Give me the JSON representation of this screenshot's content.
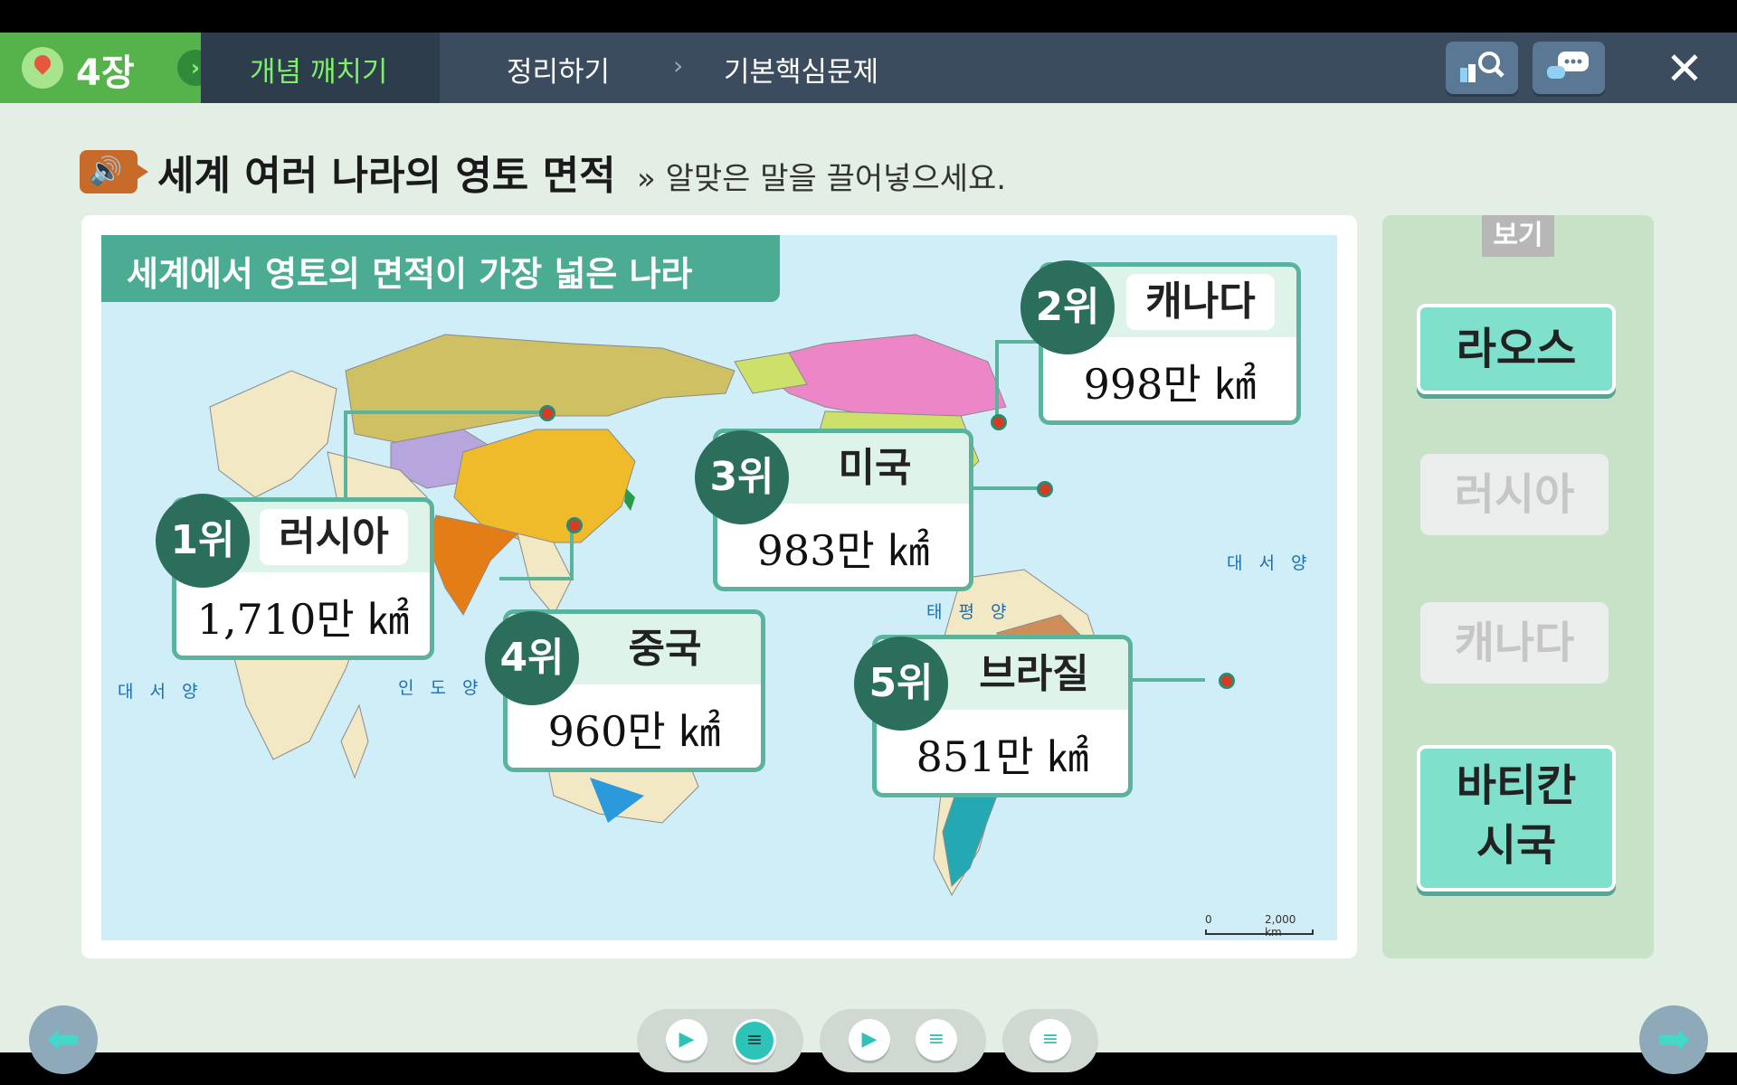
{
  "topbar": {
    "chapter": "4장",
    "tabs": [
      "개념 깨치기",
      "정리하기",
      "기본핵심문제"
    ],
    "separator": "›",
    "close_label": "✕"
  },
  "heading": {
    "title": "세계 여러 나라의 영토 면적",
    "instruction": "» 알맞은 말을 끌어넣으세요."
  },
  "map": {
    "title": "세계에서 영토의 면적이 가장 넓은 나라",
    "oceans": [
      "대 서 양",
      "인 도 양",
      "태 평 양",
      "대 서 양"
    ],
    "scale": {
      "zero": "0",
      "distance": "2,000 km"
    },
    "ranks": [
      {
        "rank": "1위",
        "country": "러시아",
        "area": "1,710만 ㎢"
      },
      {
        "rank": "2위",
        "country": "캐나다",
        "area": "998만 ㎢"
      },
      {
        "rank": "3위",
        "country": "미국",
        "area": "983만 ㎢"
      },
      {
        "rank": "4위",
        "country": "중국",
        "area": "960만 ㎢"
      },
      {
        "rank": "5위",
        "country": "브라질",
        "area": "851만 ㎢"
      }
    ]
  },
  "options": {
    "label": "보기",
    "items": [
      "라오스",
      "러시아",
      "캐나다",
      "바티칸\n시국"
    ]
  },
  "colors": {
    "accent": "#4bab93",
    "topbar": "#3b4c5e",
    "chapter": "#56b24a"
  }
}
